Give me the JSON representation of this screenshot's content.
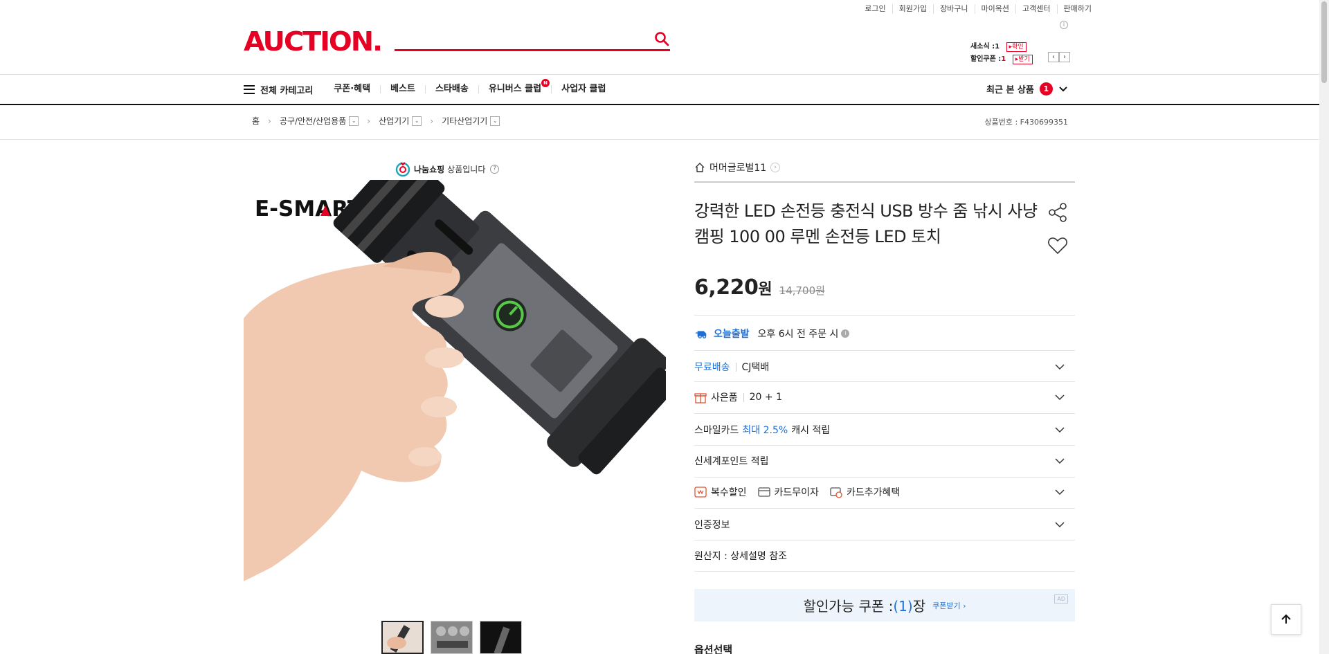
{
  "utility": [
    "로그인",
    "회원가입",
    "장바구니",
    "마이옥션",
    "고객센터",
    "판매하기"
  ],
  "logo": "AUCTION.",
  "search": {
    "placeholder": ""
  },
  "mini": {
    "news_label": "새소식 :",
    "news_count": "1",
    "news_btn": "▸확인",
    "coupon_label": "할인쿠폰 :",
    "coupon_count": "1",
    "coupon_btn": "▸받기"
  },
  "nav": {
    "all_categories": "전체 카테고리",
    "items": [
      "쿠폰·혜택",
      "베스트",
      "스타배송",
      "유니버스 클럽",
      "사업자 클럽"
    ],
    "universe_badge": "N",
    "recent_label": "최근 본 상품",
    "recent_count": "1"
  },
  "breadcrumb": {
    "home": "홈",
    "levels": [
      "공구/안전/산업용품",
      "산업기기",
      "기타산업기기"
    ],
    "item_no": "상품번호 : F430699351"
  },
  "product_image": {
    "brand_prefix": "나눔쇼핑",
    "brand_suffix": "상품입니다",
    "image_brand": "E-SMARTER"
  },
  "seller": "머머글로벌11",
  "title": "강력한 LED 손전등 충전식 USB 방수 줌 낚시 사냥 캠핑 100 00 루멘 손전등 LED 토치",
  "price": {
    "now": "6,220",
    "won": "원",
    "old": "14,700원"
  },
  "shipping_today": {
    "label": "오늘출발",
    "text": "오후 6시 전 주문 시"
  },
  "rows": {
    "delivery_free": "무료배송",
    "delivery_company": "CJ택배",
    "gift_label": "사은품",
    "gift_value": "20 + 1",
    "smile_prefix": "스마일카드",
    "smile_rate": "최대 2.5%",
    "smile_suffix": "캐시 적립",
    "shinsegae": "신세계포인트 적립",
    "multi_discount": "복수할인",
    "card_free": "카드무이자",
    "card_extra": "카드추가혜택",
    "certification": "인증정보",
    "origin": "원산지 : 상세설명 참조"
  },
  "coupon": {
    "label": "할인가능 쿠폰 :",
    "count": "(1)",
    "unit": "장",
    "get": "쿠폰받기 ›",
    "ad": "AD"
  },
  "option_title": "옵션선택",
  "colors": {
    "brand_red": "#e60023",
    "blue": "#1d6fd8",
    "coupon_bg": "#eef4fc"
  }
}
